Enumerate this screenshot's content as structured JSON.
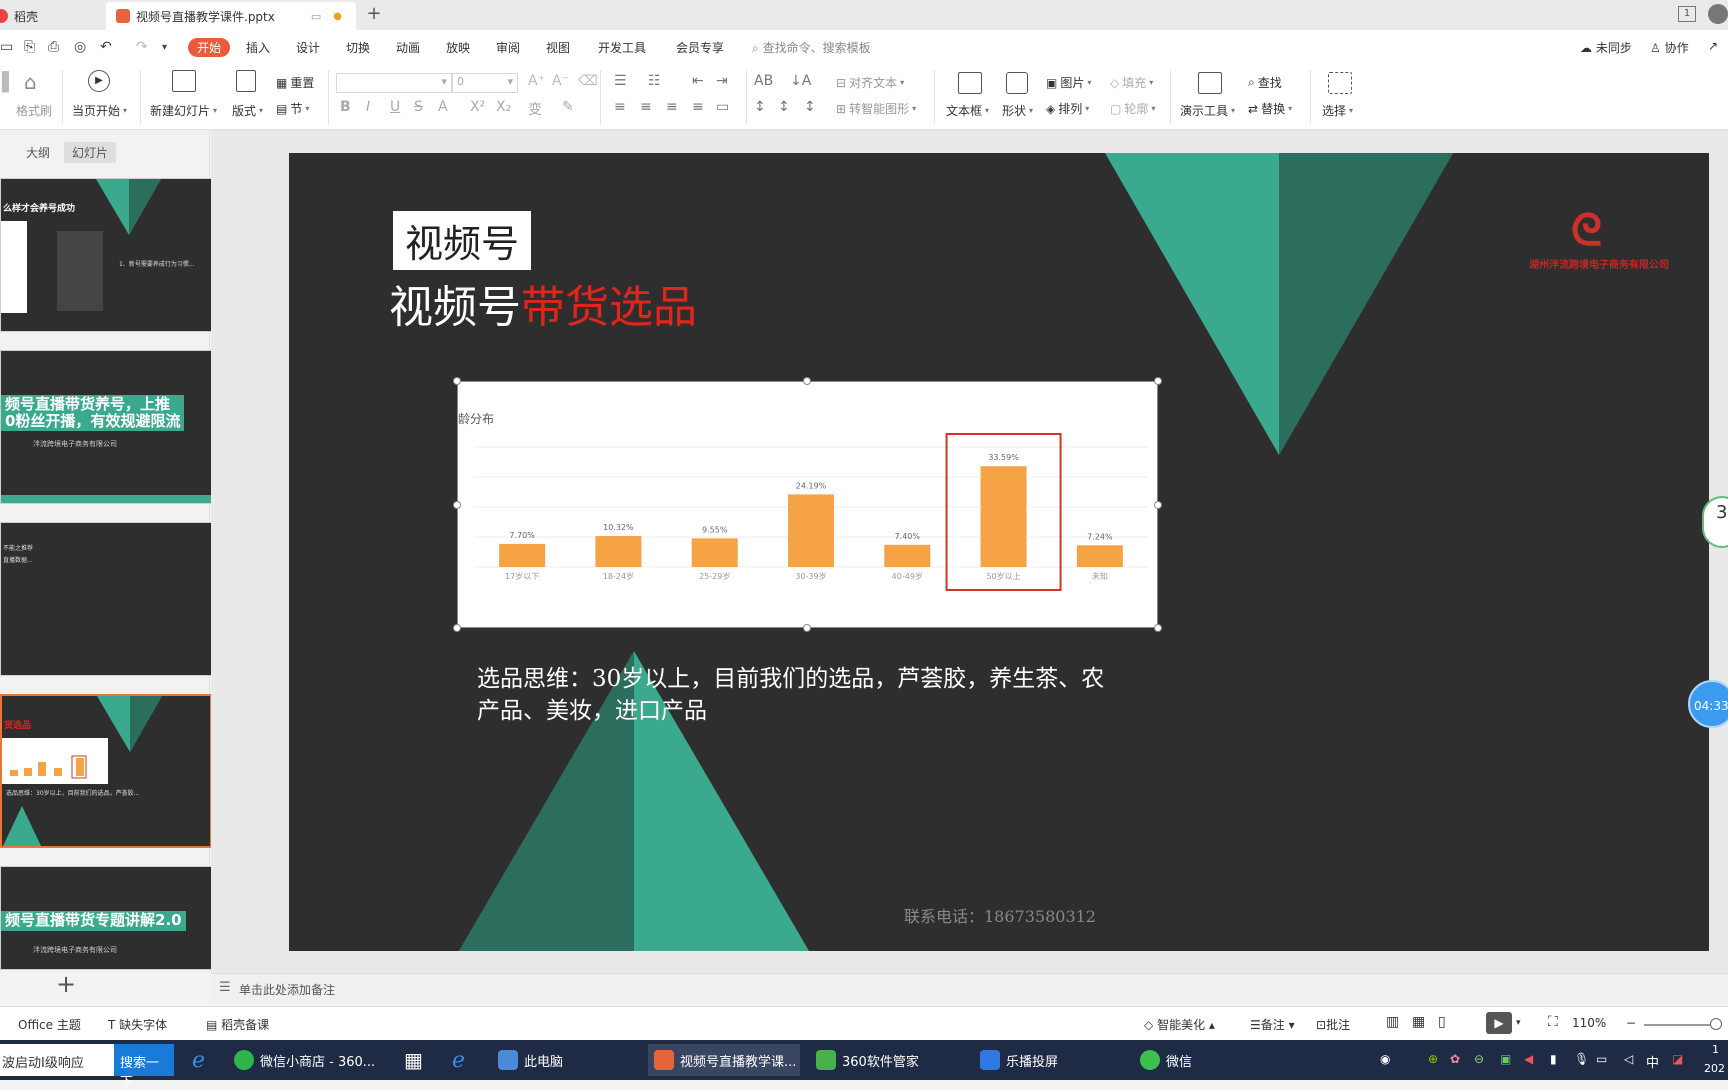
{
  "tabs": [
    {
      "label": "稻壳",
      "color": "#e44"
    },
    {
      "label": "视频号直播教学课件.pptx",
      "color": "#e8653b",
      "status_dot": "●"
    }
  ],
  "titlebar": {
    "new_tab": "+",
    "page_indicator": "1"
  },
  "menu": {
    "items": [
      "开始",
      "插入",
      "设计",
      "切换",
      "动画",
      "放映",
      "审阅",
      "视图",
      "开发工具",
      "会员专享"
    ],
    "search_placeholder": "查找命令、搜索模板",
    "sync": "未同步",
    "collab": "协作"
  },
  "ribbon": {
    "format_painter": "格式刷",
    "play_from_current": "当页开始",
    "new_slide": "新建幻灯片",
    "layout": "版式",
    "section": "节",
    "reset": "重置",
    "font_size": "0",
    "align_text": "对齐文本",
    "to_smartart": "转智能图形",
    "textbox": "文本框",
    "shape": "形状",
    "picture": "图片",
    "arrange": "排列",
    "fill": "填充",
    "outline": "轮廓",
    "presentation_tools": "演示工具",
    "find": "查找",
    "replace": "替换",
    "select": "选择"
  },
  "left_panel": {
    "tab_outline": "大纲",
    "tab_slides": "幻灯片",
    "thumbs": [
      {
        "title": "么样才会养号成功",
        "note": "1、新号需要养成行为习惯..."
      },
      {
        "banner": "频号直播带货养号，上推\n0粉丝开播，有效规避限流",
        "sub": "泮流跨境电子商务有限公司"
      },
      {
        "title": "不能之推荐",
        "note": "直播数据..."
      },
      {
        "title": "货选品",
        "note": "选品思维：30岁以上，目前我们的选品，芦荟胶..."
      },
      {
        "banner": "频号直播带货专题讲解2.0",
        "sub": "泮流跨境电子商务有限公司"
      }
    ],
    "add": "+"
  },
  "slide": {
    "tag": "视频号",
    "title_white": "视频号",
    "title_red": "带货选品",
    "logo_text": "湖州泮流跨境电子商务有限公司",
    "body": "选品思维：30岁以上，目前我们的选品，芦荟胶，养生茶、农产品、美妆，进口产品",
    "contact": "联系电话：18673580312"
  },
  "chart_data": {
    "type": "bar",
    "title": "龄分布",
    "categories": [
      "17岁以下",
      "18-24岁",
      "25-29岁",
      "30-39岁",
      "40-49岁",
      "50岁以上",
      "未知"
    ],
    "values": [
      7.7,
      10.32,
      9.55,
      24.19,
      7.4,
      33.59,
      7.24
    ],
    "labels": [
      "7.70%",
      "10.32%",
      "9.55%",
      "24.19%",
      "7.40%",
      "33.59%",
      "7.24%"
    ],
    "ylim": [
      0,
      40
    ],
    "highlight_index": 5,
    "bar_color": "#f5a345",
    "highlight_color": "#d8332b",
    "grid": true
  },
  "floating": {
    "timer": "04:33",
    "badge": "3"
  },
  "notes": {
    "placeholder": "单击此处添加备注"
  },
  "status": {
    "theme": "Office 主题",
    "missing_font": "缺失字体",
    "docer": "稻壳备课",
    "smart_beautify": "智能美化",
    "notes": "备注",
    "comments": "批注",
    "zoom": "110%"
  },
  "taskbar": {
    "search_text": "波启动I级响应",
    "search_btn": "搜索一下",
    "items": [
      {
        "label": "微信小商店 - 360...",
        "color": "#2fb44a"
      },
      {
        "label": "此电脑",
        "color": "#4a8ad6"
      },
      {
        "label": "视频号直播教学课...",
        "color": "#e8653b"
      },
      {
        "label": "360软件管家",
        "color": "#4ab04a"
      },
      {
        "label": "乐播投屏",
        "color": "#2f7ae0"
      },
      {
        "label": "微信",
        "color": "#3cbf4c"
      }
    ],
    "ime": "中",
    "clock_top": "1",
    "clock_bottom": "202"
  }
}
